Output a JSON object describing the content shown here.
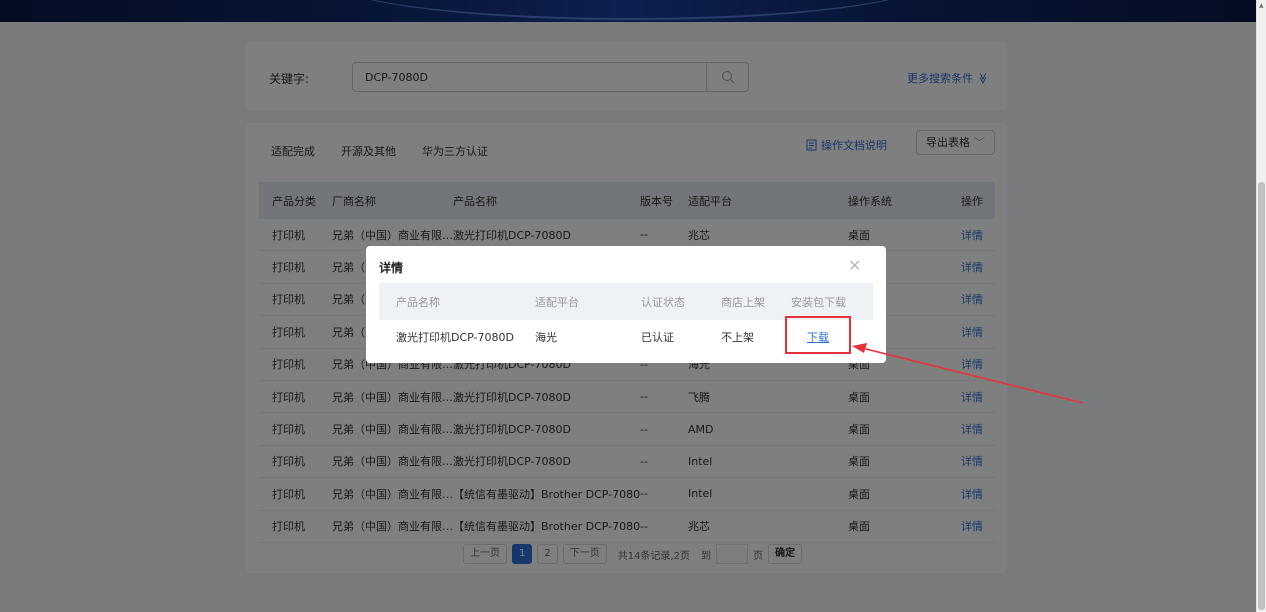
{
  "search": {
    "label": "关键字:",
    "value": "DCP-7080D",
    "more_conditions": "更多搜索条件",
    "more_chevron": "≫"
  },
  "tabs": [
    "适配完成",
    "开源及其他",
    "华为三方认证"
  ],
  "toolbar": {
    "doc_link": "操作文档说明",
    "export_label": "导出表格",
    "export_arrow": "﹀"
  },
  "table": {
    "headers": [
      "产品分类",
      "厂商名称",
      "产品名称",
      "版本号",
      "适配平台",
      "操作系统",
      "操作"
    ],
    "rows": [
      [
        "打印机",
        "兄弟（中国）商业有限…",
        "激光打印机DCP-7080D",
        "--",
        "兆芯",
        "桌面",
        "详情"
      ],
      [
        "打印机",
        "兄弟（中",
        "",
        "",
        "",
        "",
        "详情"
      ],
      [
        "打印机",
        "兄弟（中",
        "",
        "",
        "",
        "",
        "详情"
      ],
      [
        "打印机",
        "兄弟（中",
        "",
        "",
        "",
        "",
        "详情"
      ],
      [
        "打印机",
        "兄弟（中国）商业有限…",
        "激光打印机DCP-7080D",
        "--",
        "海光",
        "桌面",
        "详情"
      ],
      [
        "打印机",
        "兄弟（中国）商业有限…",
        "激光打印机DCP-7080D",
        "--",
        "飞腾",
        "桌面",
        "详情"
      ],
      [
        "打印机",
        "兄弟（中国）商业有限…",
        "激光打印机DCP-7080D",
        "--",
        "AMD",
        "桌面",
        "详情"
      ],
      [
        "打印机",
        "兄弟（中国）商业有限…",
        "激光打印机DCP-7080D",
        "--",
        "Intel",
        "桌面",
        "详情"
      ],
      [
        "打印机",
        "兄弟（中国）商业有限…",
        "【统信有墨驱动】Brother DCP-7080D …",
        "--",
        "Intel",
        "桌面",
        "详情"
      ],
      [
        "打印机",
        "兄弟（中国）商业有限…",
        "【统信有墨驱动】Brother DCP-7080D …",
        "--",
        "兆芯",
        "桌面",
        "详情"
      ]
    ]
  },
  "pagination": {
    "prev": "上一页",
    "page1": "1",
    "page2": "2",
    "next": "下一页",
    "summary": "共14条记录,2页",
    "goto": "到",
    "page_unit": "页",
    "confirm": "确定"
  },
  "modal": {
    "title": "详情",
    "close": "✕",
    "headers": [
      "产品名称",
      "适配平台",
      "认证状态",
      "商店上架",
      "安装包下载"
    ],
    "row": {
      "product": "激光打印机DCP-7080D",
      "platform": "海光",
      "cert_status": "已认证",
      "store": "不上架",
      "download": "下载"
    }
  },
  "colors": {
    "accent": "#2f6fd8",
    "highlight": "#e8303a"
  }
}
